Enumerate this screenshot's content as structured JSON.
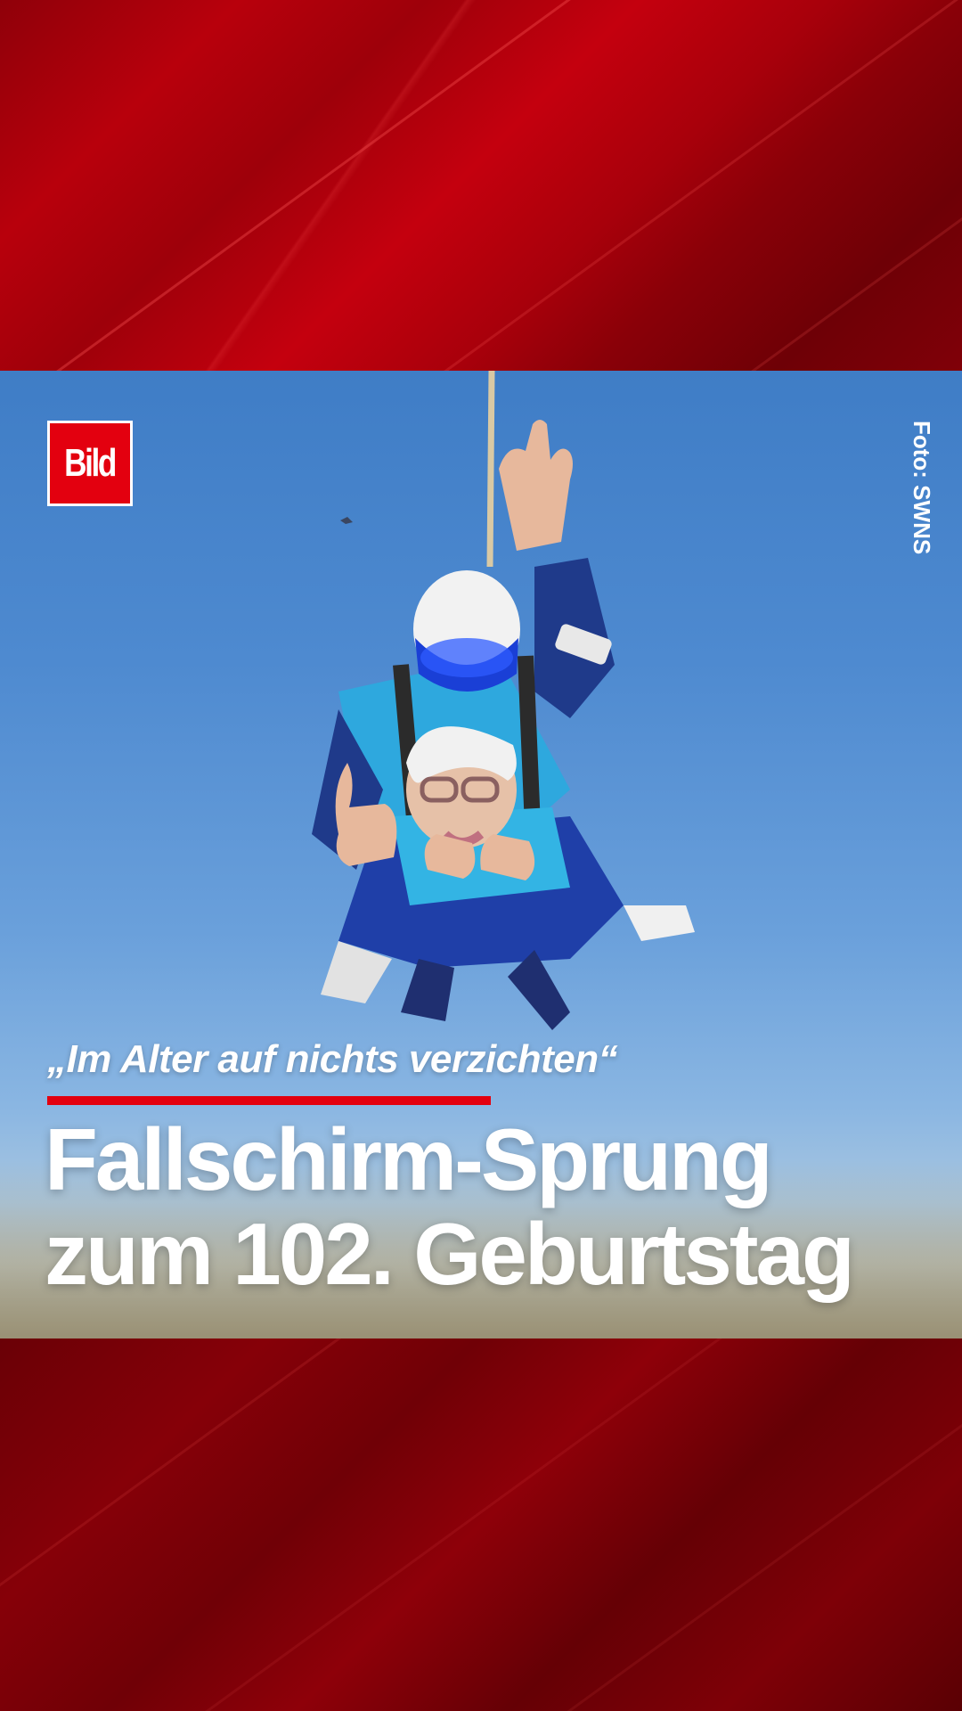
{
  "brand": {
    "logo_text": "Bild",
    "accent_color": "#e3000f"
  },
  "photo": {
    "credit": "Foto: SWNS"
  },
  "story": {
    "kicker": "„Im Alter auf nichts verzichten“",
    "headline_line_1": "Fallschirm-Sprung",
    "headline_line_2": "zum 102. Geburtstag"
  }
}
